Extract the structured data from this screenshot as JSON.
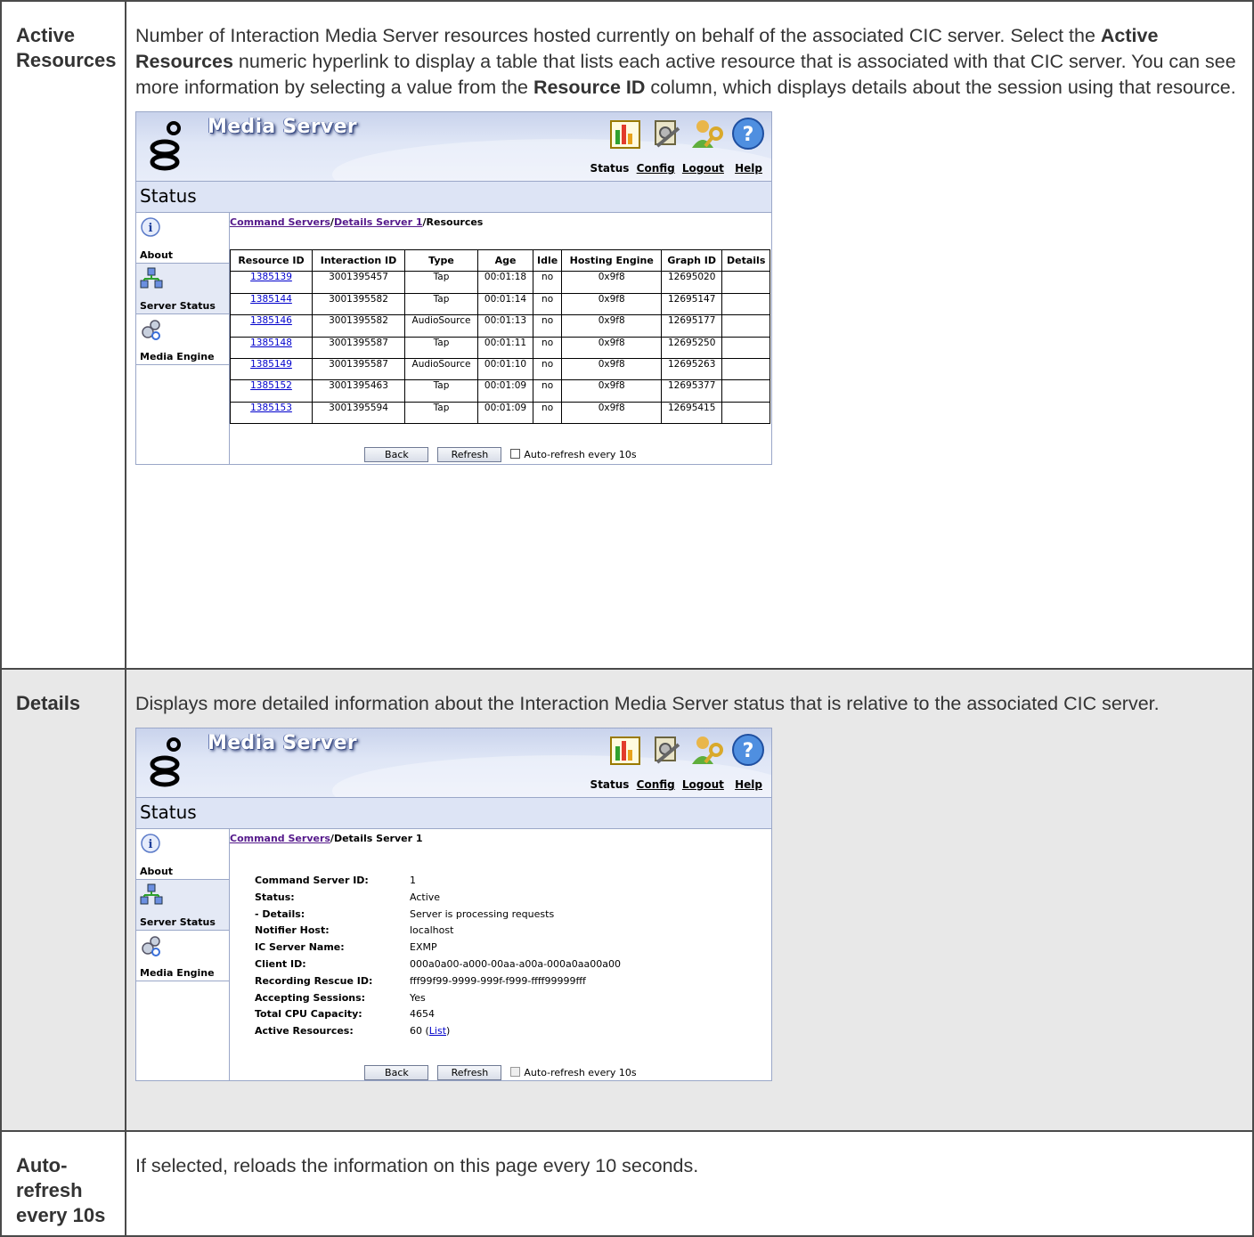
{
  "rows": {
    "active": {
      "label": "Active Resources",
      "desc_1": "Number of Interaction Media Server resources hosted currently on behalf of the associated CIC server. Select the ",
      "desc_b1": "Active Resources",
      "desc_2": " numeric hyperlink to display a table that lists each active resource that is associated with that CIC server. You can see more information by selecting a value from the ",
      "desc_b2": "Resource ID",
      "desc_3": " column, which displays details about the session using that resource."
    },
    "details": {
      "label": "Details",
      "desc": "Displays more detailed information about the Interaction Media Server status that is relative to the associated CIC server."
    },
    "auto": {
      "label": "Auto-refresh every 10s",
      "desc": "If selected, reloads the information on this page every 10 seconds."
    }
  },
  "media_server": {
    "title": "Media Server",
    "nav": {
      "status": "Status",
      "config": "Config",
      "logout": "Logout",
      "help": "Help"
    },
    "page_heading": "Status",
    "sidebar": {
      "about": "About",
      "server_status": "Server Status",
      "media_engine": "Media Engine"
    },
    "buttons": {
      "back": "Back",
      "refresh": "Refresh",
      "auto_refresh": "Auto-refresh every 10s"
    },
    "colors": {
      "header_bg": "#c9d3ec",
      "link": "#0000cc",
      "visited_link": "#551a8b"
    }
  },
  "resources_view": {
    "crumb_1": "Command Servers",
    "crumb_2": "Details Server 1",
    "crumb_3": "Resources",
    "columns": [
      "Resource ID",
      "Interaction ID",
      "Type",
      "Age",
      "Idle",
      "Hosting Engine",
      "Graph ID",
      "Details"
    ],
    "rows": [
      [
        "1385139",
        "3001395457",
        "Tap",
        "00:01:18",
        "no",
        "0x9f8",
        "12695020",
        ""
      ],
      [
        "1385144",
        "3001395582",
        "Tap",
        "00:01:14",
        "no",
        "0x9f8",
        "12695147",
        ""
      ],
      [
        "1385146",
        "3001395582",
        "AudioSource",
        "00:01:13",
        "no",
        "0x9f8",
        "12695177",
        ""
      ],
      [
        "1385148",
        "3001395587",
        "Tap",
        "00:01:11",
        "no",
        "0x9f8",
        "12695250",
        ""
      ],
      [
        "1385149",
        "3001395587",
        "AudioSource",
        "00:01:10",
        "no",
        "0x9f8",
        "12695263",
        ""
      ],
      [
        "1385152",
        "3001395463",
        "Tap",
        "00:01:09",
        "no",
        "0x9f8",
        "12695377",
        ""
      ],
      [
        "1385153",
        "3001395594",
        "Tap",
        "00:01:09",
        "no",
        "0x9f8",
        "12695415",
        ""
      ]
    ]
  },
  "details_view": {
    "crumb_1": "Command Servers",
    "crumb_2": "Details Server 1",
    "fields": [
      {
        "k": "Command Server ID:",
        "v": "1"
      },
      {
        "k": "Status:",
        "v": "Active"
      },
      {
        "k": "- Details:",
        "v": "Server is processing requests"
      },
      {
        "k": "Notifier Host:",
        "v": "localhost"
      },
      {
        "k": "IC Server Name:",
        "v": "EXMP"
      },
      {
        "k": "Client ID:",
        "v": "000a0a00-a000-00aa-a00a-000a0aa00a00"
      },
      {
        "k": "Recording Rescue ID:",
        "v": "fff99f99-9999-999f-f999-ffff99999fff"
      },
      {
        "k": "Accepting Sessions:",
        "v": "Yes"
      },
      {
        "k": "Total CPU Capacity:",
        "v": "4654"
      }
    ],
    "active_resources_label": "Active Resources:",
    "active_resources_count": "60",
    "list_link": "List"
  }
}
